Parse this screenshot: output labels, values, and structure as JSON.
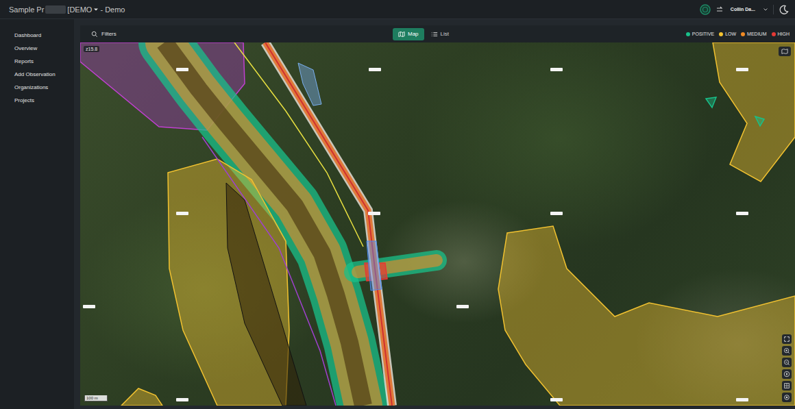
{
  "header": {
    "title": "Sample Pr",
    "title_tag": "[DEMO",
    "title_suffix": "- Demo",
    "user": "Collin Da..."
  },
  "sidebar": {
    "items": [
      {
        "label": "Dashboard",
        "selected": false
      },
      {
        "label": "Overview",
        "selected": false
      },
      {
        "label": "Reports",
        "selected": false
      },
      {
        "label": "Add Observation",
        "selected": false
      },
      {
        "label": "Organizations",
        "selected": false
      },
      {
        "label": "Projects",
        "selected": false
      }
    ]
  },
  "toolbar": {
    "filters": "Filters",
    "views": [
      {
        "label": "Map",
        "selected": true
      },
      {
        "label": "List",
        "selected": false
      }
    ],
    "legend": [
      {
        "label": "POSITIVE",
        "color": "#19c08a"
      },
      {
        "label": "LOW",
        "color": "#f2c230"
      },
      {
        "label": "MEDIUM",
        "color": "#f08a24"
      },
      {
        "label": "HIGH",
        "color": "#e53935"
      }
    ]
  },
  "map": {
    "zoom": "z15.8",
    "scale": "100 m",
    "zones": [
      {
        "kind": "corridor",
        "risk": "POSITIVE"
      },
      {
        "kind": "corridor",
        "risk": "MEDIUM"
      },
      {
        "kind": "polygon",
        "risk": "LOW"
      },
      {
        "kind": "polygon",
        "risk": "LOW"
      },
      {
        "kind": "polygon",
        "risk": "LOW"
      },
      {
        "kind": "polygon",
        "risk": "LOW"
      },
      {
        "kind": "corridor",
        "risk": "POSITIVE"
      },
      {
        "kind": "corridor",
        "risk": "MEDIUM"
      },
      {
        "kind": "polygon",
        "risk": "HIGH"
      },
      {
        "kind": "polygon",
        "risk": "POSITIVE"
      },
      {
        "kind": "polygon",
        "risk": "POSITIVE"
      }
    ]
  }
}
